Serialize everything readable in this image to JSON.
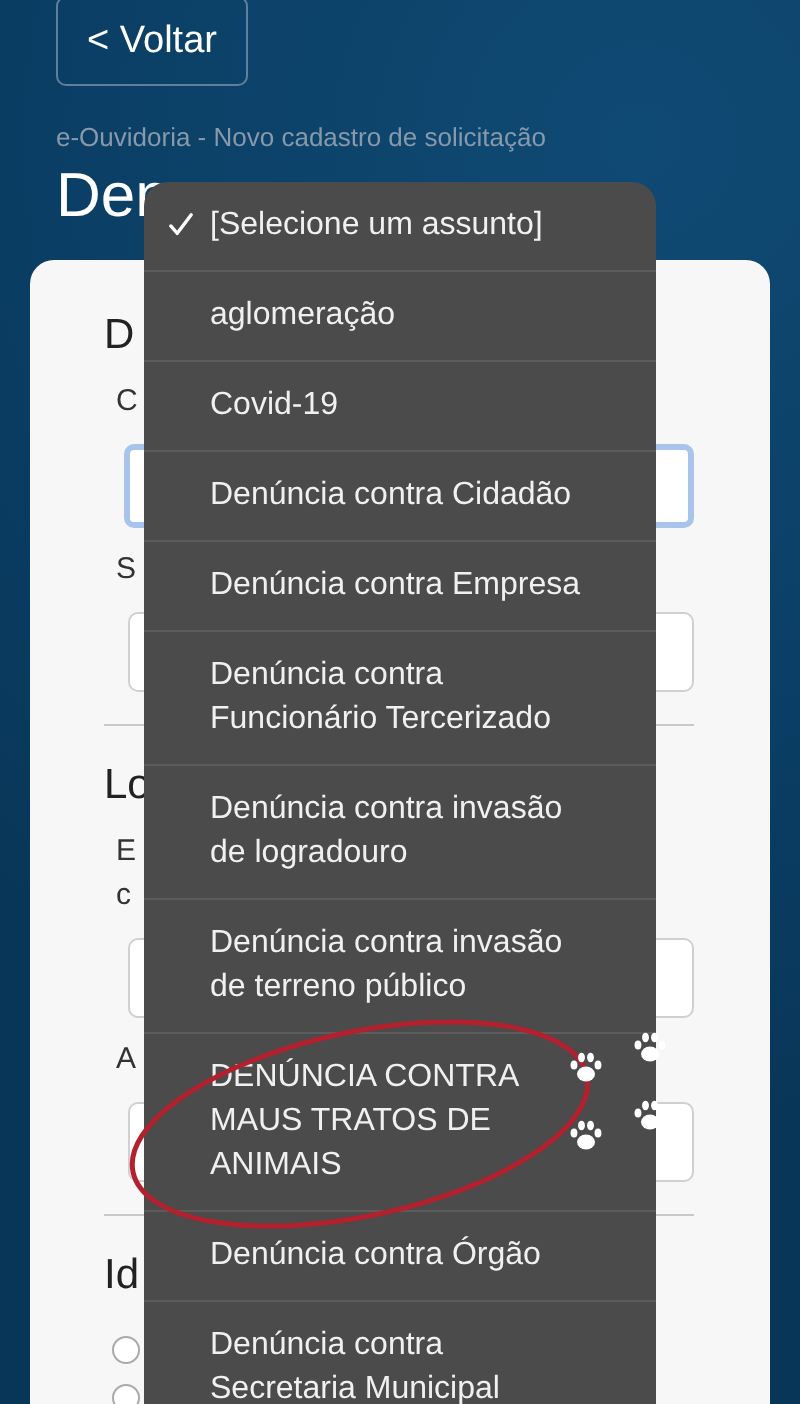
{
  "back_button": {
    "label": "< Voltar"
  },
  "breadcrumb": "e-Ouvidoria - Novo cadastro de solicitação",
  "page_title": "Den",
  "form": {
    "sections": [
      {
        "heading": "D",
        "fields": [
          {
            "label": "C",
            "focused": true
          },
          {
            "label": "S",
            "focused": false
          }
        ]
      },
      {
        "heading": "Lo",
        "fields": [
          {
            "label": "E\nc",
            "focused": false
          },
          {
            "label": "A",
            "focused": false
          }
        ]
      },
      {
        "heading": "Id"
      }
    ],
    "radios": [
      {
        "selected": false
      },
      {
        "selected": false
      }
    ]
  },
  "dropdown": {
    "items": [
      {
        "label": "[Selecione um assunto]",
        "selected": true
      },
      {
        "label": "aglomeração",
        "selected": false
      },
      {
        "label": "Covid-19",
        "selected": false
      },
      {
        "label": "Denúncia contra Cidadão",
        "selected": false
      },
      {
        "label": "Denúncia contra Empresa",
        "selected": false
      },
      {
        "label": "Denúncia contra\nFuncionário Tercerizado",
        "selected": false
      },
      {
        "label": "Denúncia contra invasão\nde logradouro",
        "selected": false
      },
      {
        "label": "Denúncia contra invasão\nde terreno público",
        "selected": false
      },
      {
        "label": "DENÚNCIA CONTRA\nMAUS TRATOS DE\nANIMAIS",
        "selected": false
      },
      {
        "label": "Denúncia contra Órgão",
        "selected": false
      },
      {
        "label": "Denúncia contra\nSecretaria Municipal",
        "selected": false
      }
    ]
  }
}
